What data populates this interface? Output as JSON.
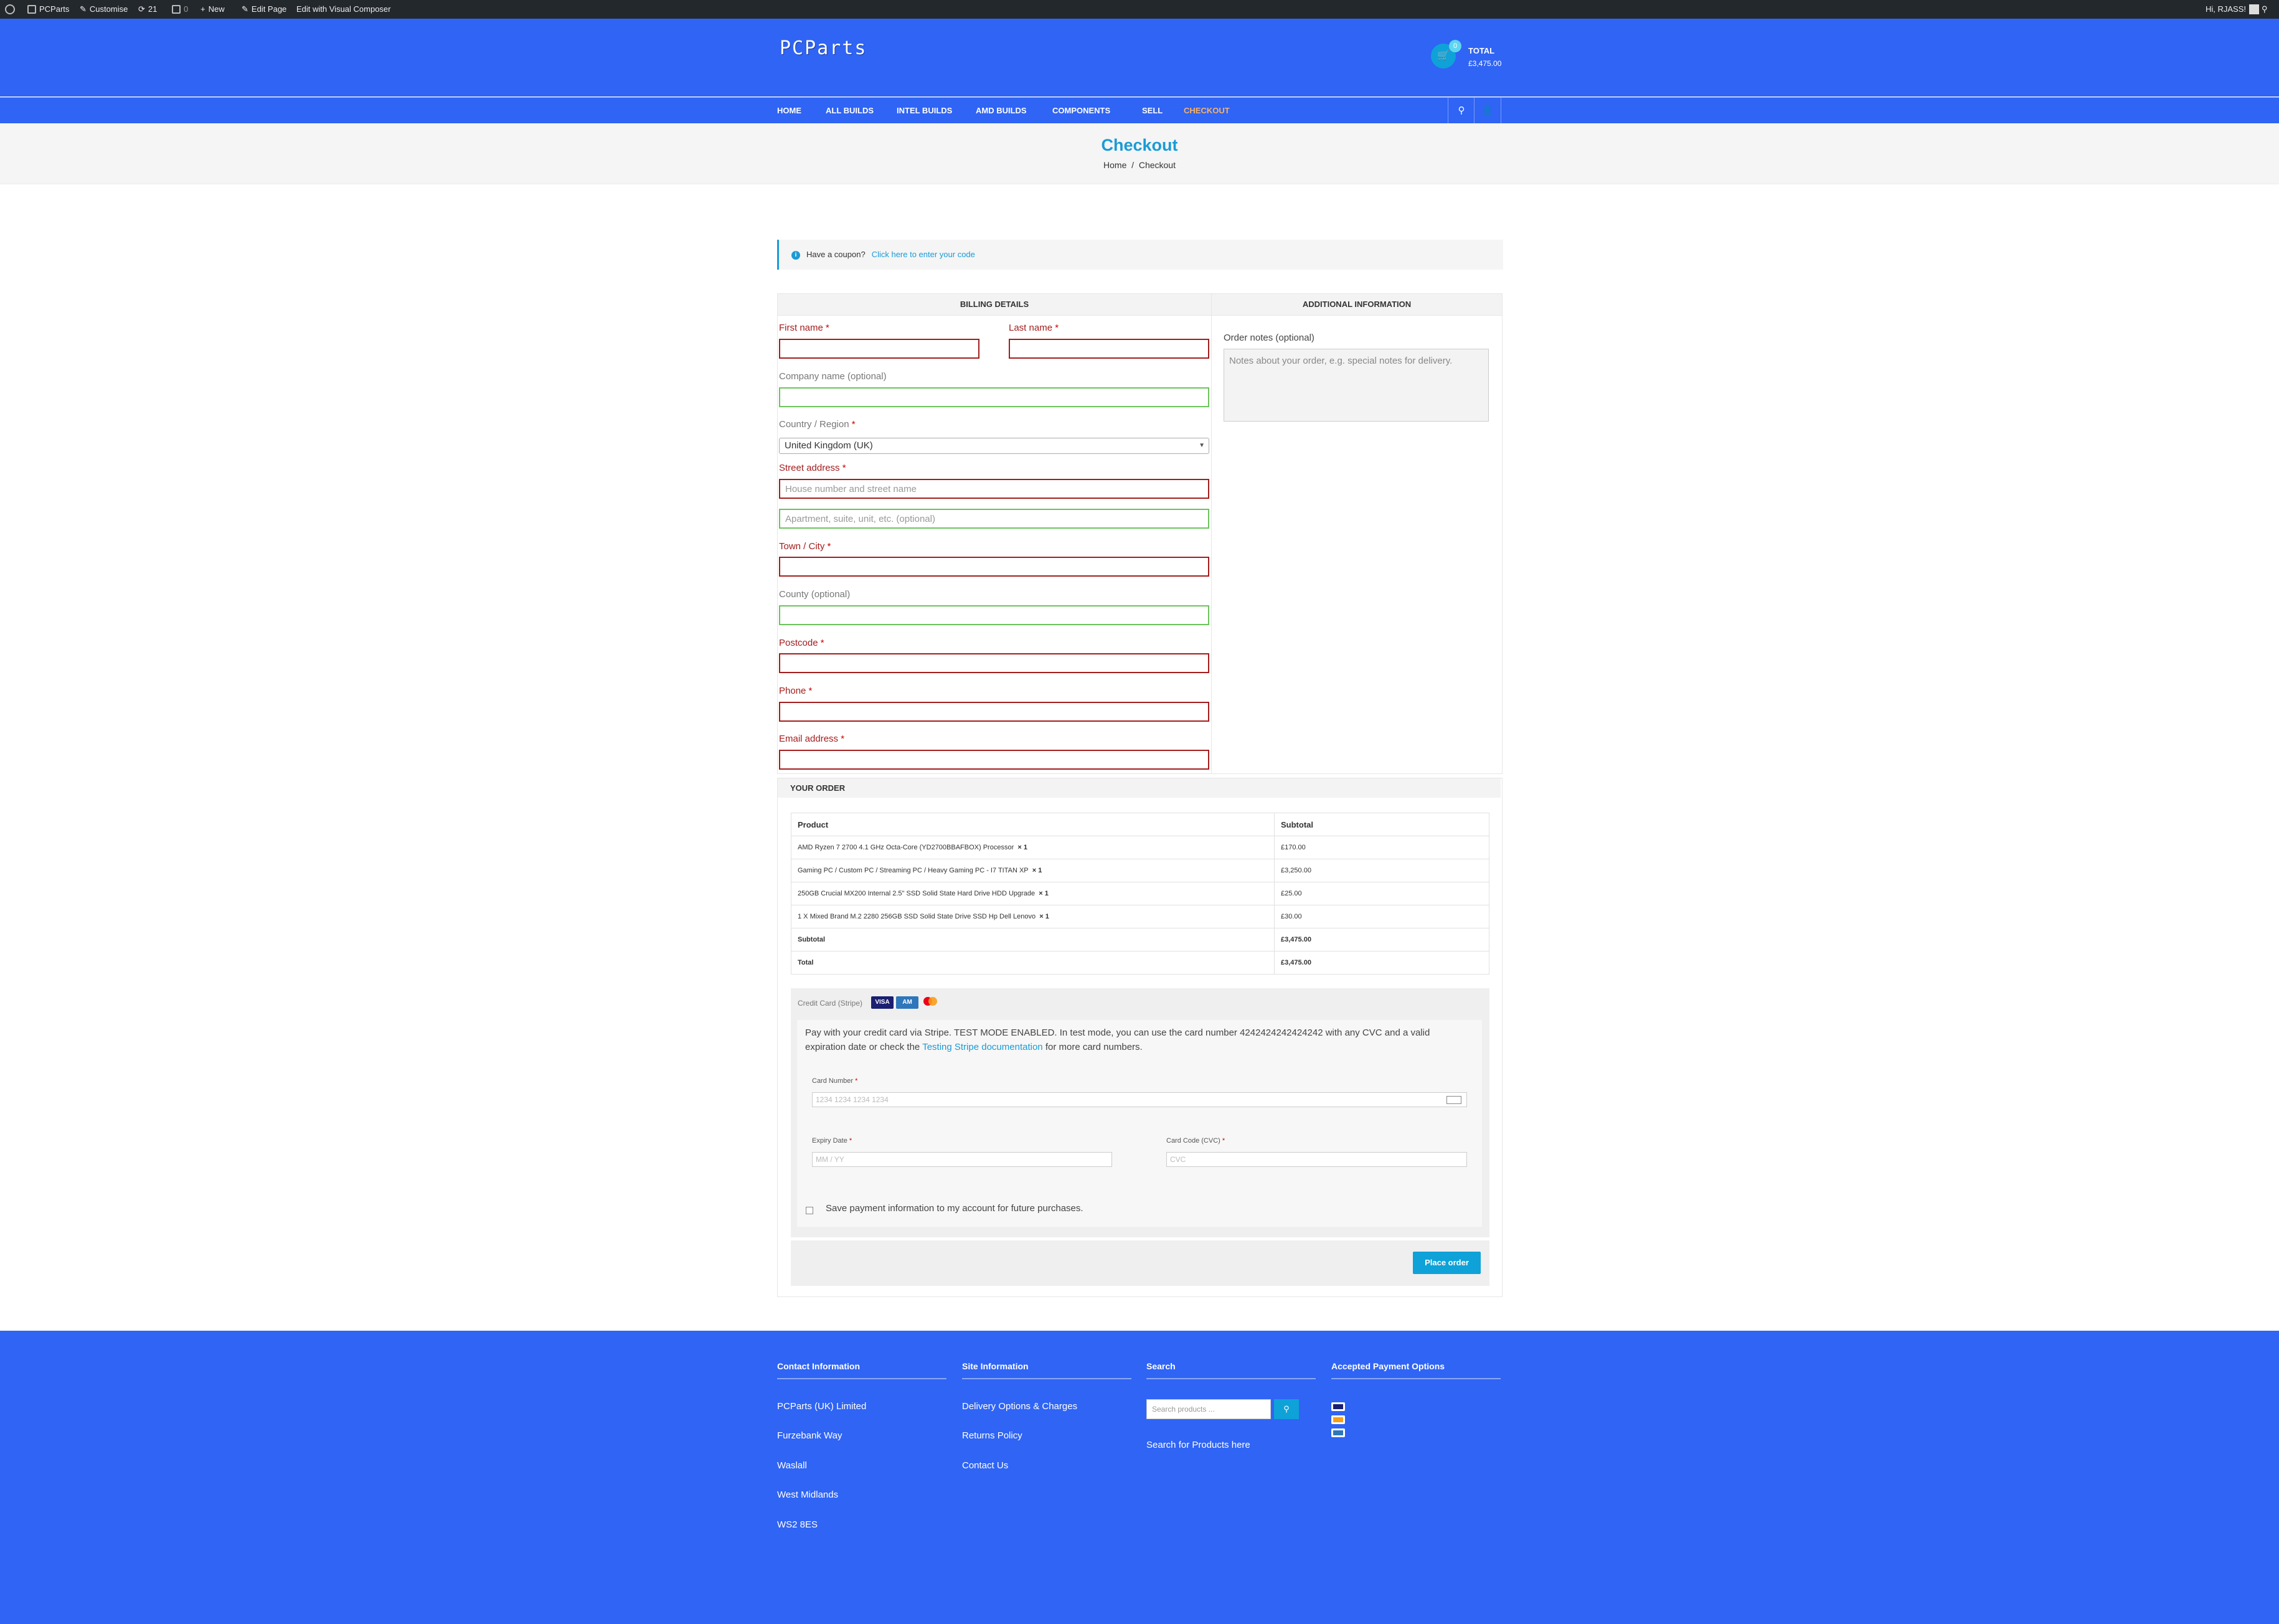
{
  "admin_bar": {
    "site": "PCParts",
    "customise": "Customise",
    "updates": "21",
    "comments": "0",
    "new": "New",
    "edit_page": "Edit Page",
    "edit_vc": "Edit with Visual Composer",
    "greeting": "Hi, RJASS!"
  },
  "header": {
    "logo": "PCParts",
    "cart_count": "0",
    "total_label": "TOTAL",
    "total_value": "£3,475.00"
  },
  "nav": {
    "items": [
      "HOME",
      "ALL BUILDS",
      "INTEL BUILDS",
      "AMD BUILDS",
      "COMPONENTS",
      "SELL",
      "CHECKOUT"
    ]
  },
  "page": {
    "title": "Checkout",
    "breadcrumb_home": "Home",
    "breadcrumb_sep": "/",
    "breadcrumb_current": "Checkout"
  },
  "coupon": {
    "question": "Have a coupon?",
    "link": "Click here to enter your code"
  },
  "billing": {
    "heading": "BILLING DETAILS",
    "first_name": "First name",
    "last_name": "Last name",
    "company": "Company name (optional)",
    "country": "Country / Region",
    "country_value": "United Kingdom (UK)",
    "street": "Street address",
    "street_placeholder": "House number and street name",
    "street2_placeholder": "Apartment, suite, unit, etc. (optional)",
    "town": "Town / City",
    "county": "County (optional)",
    "postcode": "Postcode",
    "phone": "Phone",
    "email": "Email address",
    "required_mark": "*"
  },
  "additional": {
    "heading": "ADDITIONAL INFORMATION",
    "notes_label": "Order notes (optional)",
    "notes_placeholder": "Notes about your order, e.g. special notes for delivery."
  },
  "order": {
    "heading": "YOUR ORDER",
    "col_product": "Product",
    "col_subtotal": "Subtotal",
    "items": [
      {
        "name": "AMD Ryzen 7 2700 4.1 GHz Octa-Core (YD2700BBAFBOX) Processor",
        "qty": "× 1",
        "price": "£170.00"
      },
      {
        "name": "Gaming PC / Custom PC / Streaming PC / Heavy Gaming PC - I7 TITAN XP",
        "qty": "× 1",
        "price": "£3,250.00"
      },
      {
        "name": "250GB Crucial MX200 Internal 2.5\" SSD Solid State Hard Drive HDD Upgrade",
        "qty": "× 1",
        "price": "£25.00"
      },
      {
        "name": "1 X Mixed Brand M.2 2280 256GB SSD Solid State Drive SSD Hp Dell Lenovo",
        "qty": "× 1",
        "price": "£30.00"
      }
    ],
    "subtotal_label": "Subtotal",
    "subtotal_value": "£3,475.00",
    "total_label": "Total",
    "total_value": "£3,475.00"
  },
  "payment": {
    "method": "Credit Card (Stripe)",
    "desc_text": "Pay with your credit card via Stripe. TEST MODE ENABLED. In test mode, you can use the card number 4242424242424242 with any CVC and a valid expiration date or check the",
    "desc_link": "Testing Stripe documentation",
    "desc_end": "for more card numbers.",
    "card_number_label": "Card Number",
    "card_number_placeholder": "1234 1234 1234 1234",
    "expiry_label": "Expiry Date",
    "expiry_placeholder": "MM / YY",
    "cvc_label": "Card Code (CVC)",
    "cvc_placeholder": "CVC",
    "save_label": "Save payment information to my account for future purchases.",
    "place_order": "Place order"
  },
  "footer": {
    "contact_heading": "Contact Information",
    "contact_lines": [
      "PCParts (UK) Limited",
      "Furzebank Way",
      "Waslall",
      "West Midlands",
      "WS2 8ES"
    ],
    "site_heading": "Site Information",
    "site_links": [
      "Delivery Options & Charges",
      "Returns Policy",
      "Contact Us"
    ],
    "search_heading": "Search",
    "search_placeholder": "Search products ...",
    "search_text": "Search for Products here",
    "payment_heading": "Accepted Payment Options"
  },
  "colors": {
    "brand_blue": "#2f64f4",
    "accent": "#1a9bd7",
    "error": "#a31d1d",
    "valid": "#6dc35d"
  }
}
